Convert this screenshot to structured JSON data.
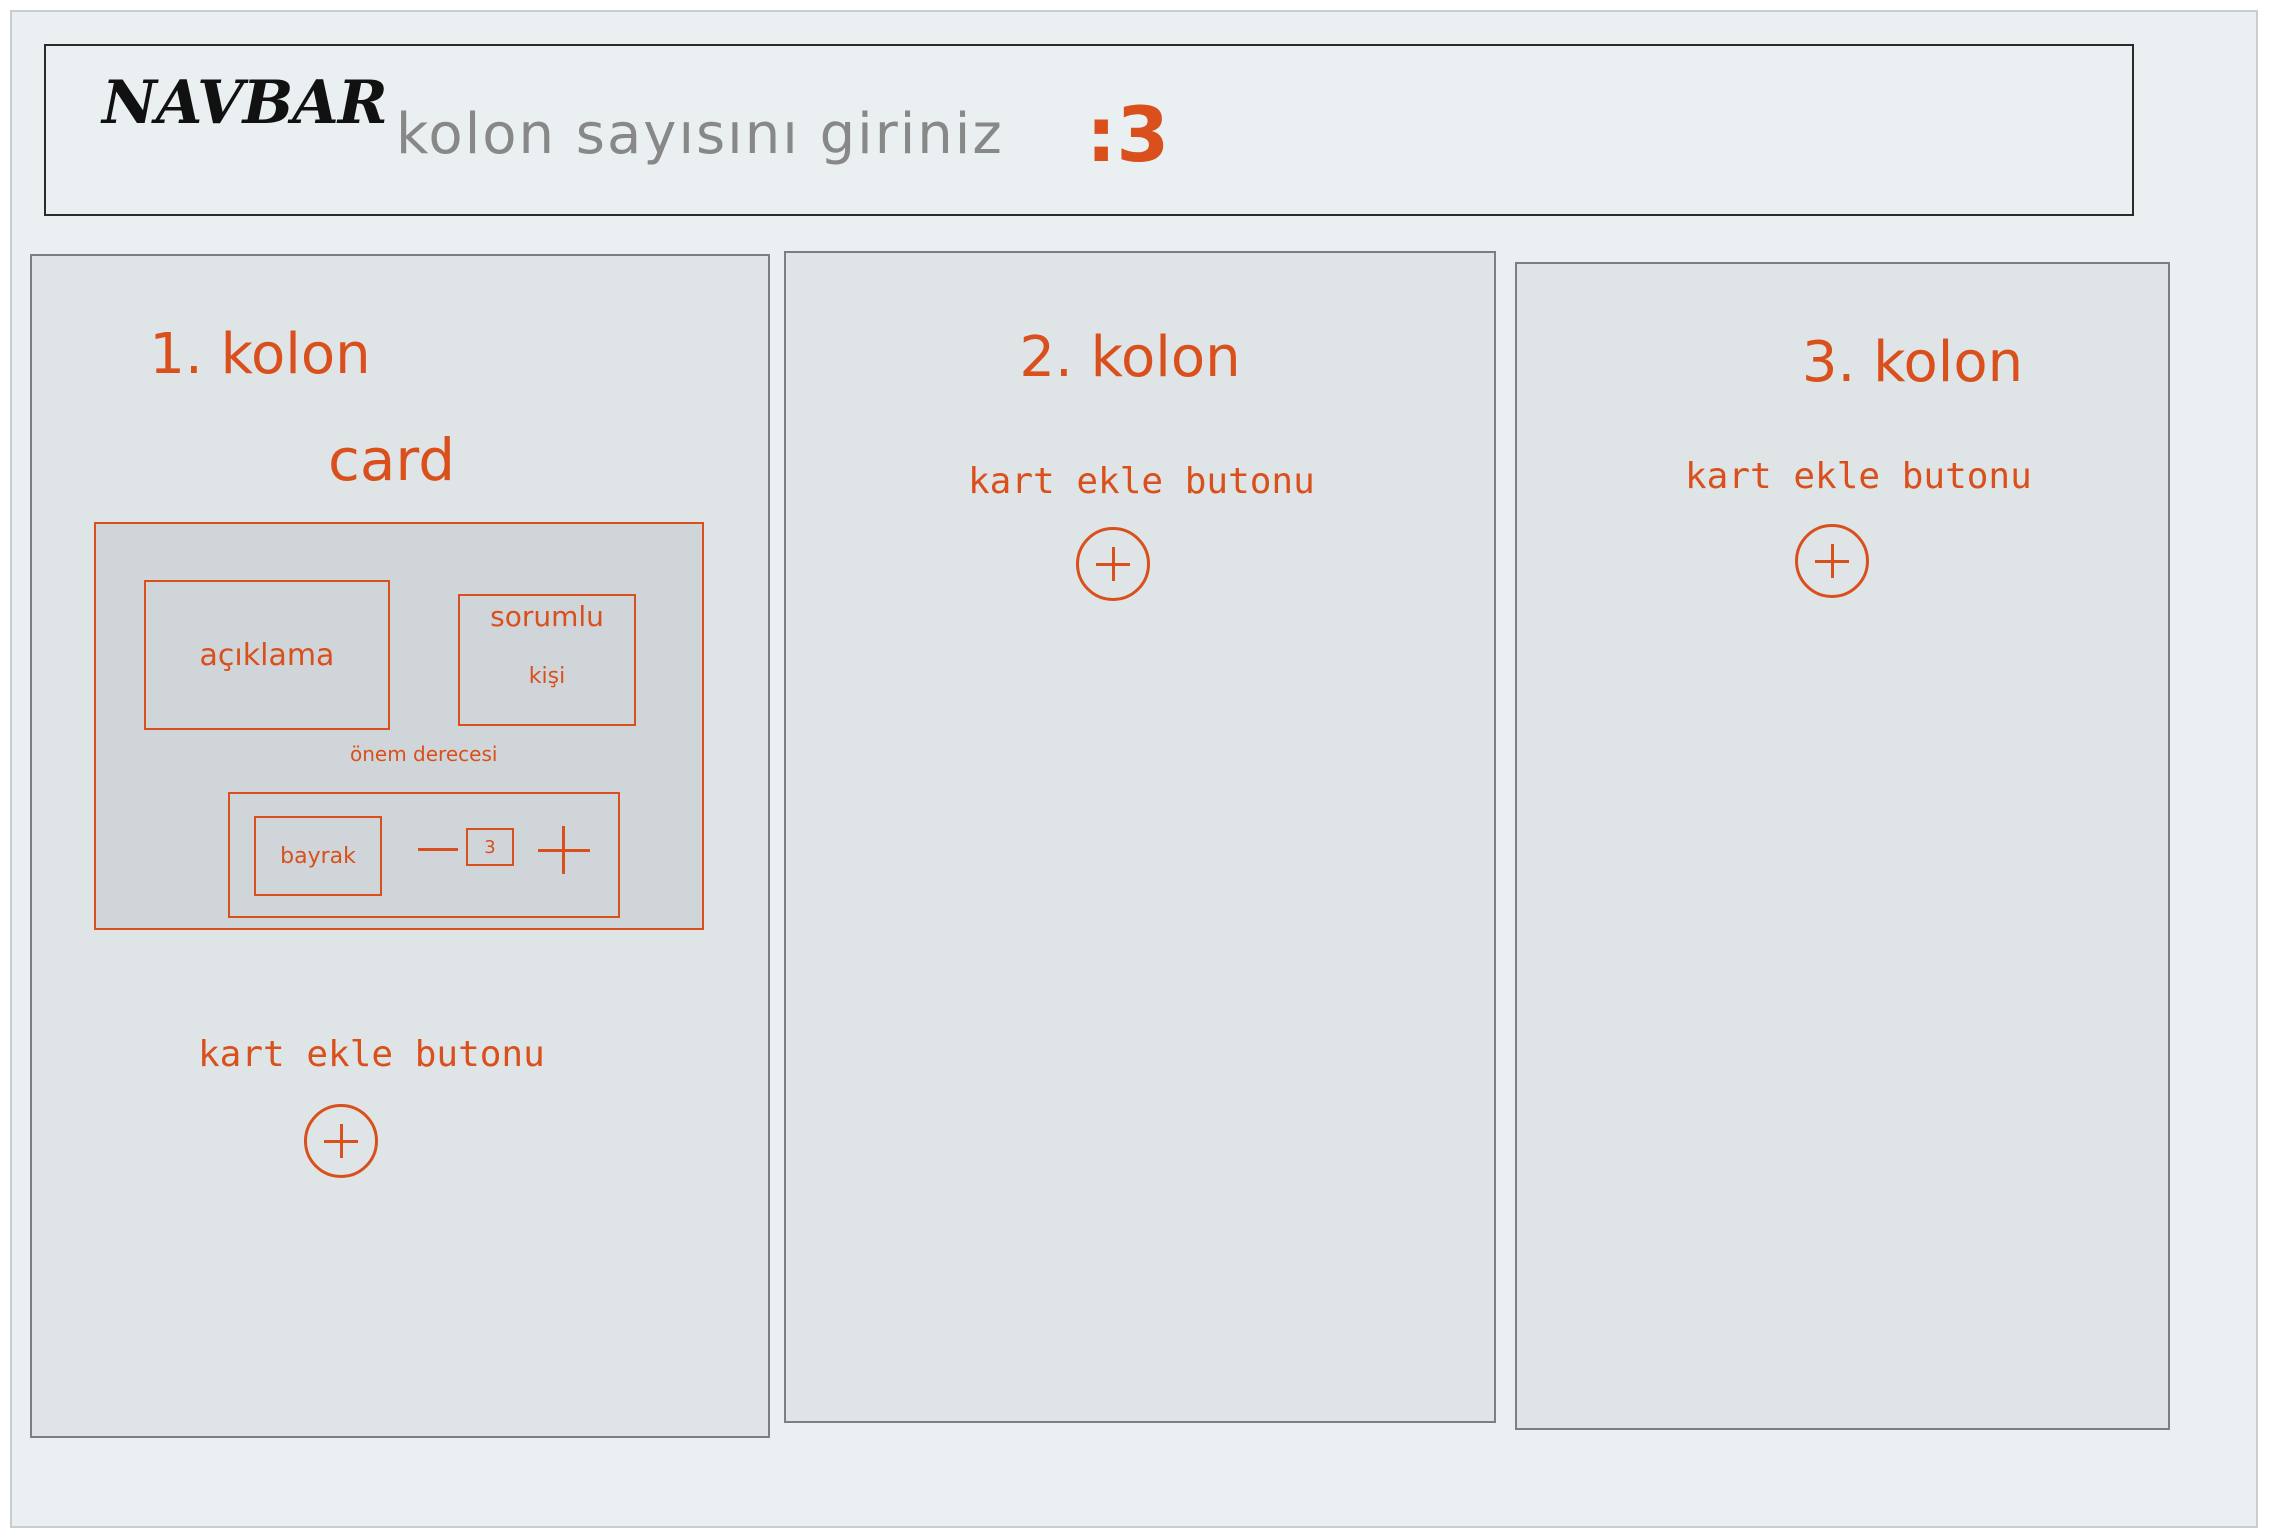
{
  "navbar": {
    "title": "NAVBAR",
    "prompt": "kolon sayısını giriniz",
    "value": ":3"
  },
  "columns": [
    {
      "title": "1. kolon",
      "card": {
        "label": "card",
        "description": "açıklama",
        "responsible_line1": "sorumlu",
        "responsible_line2": "kişi",
        "priority_label": "önem derecesi",
        "flag": "bayrak",
        "stepper_value": "3"
      },
      "add_label": "kart ekle butonu"
    },
    {
      "title": "2. kolon",
      "add_label": "kart ekle butonu"
    },
    {
      "title": "3. kolon",
      "add_label": "kart ekle butonu"
    }
  ],
  "colors": {
    "accent": "#d9501c",
    "background": "#eaeff2",
    "column": "#dfe4e7",
    "card": "#d0d5da",
    "prompt_text": "#888888"
  },
  "icons": {
    "add": "plus-icon",
    "stepper_increase": "plus-icon",
    "stepper_decrease": "minus-icon"
  }
}
